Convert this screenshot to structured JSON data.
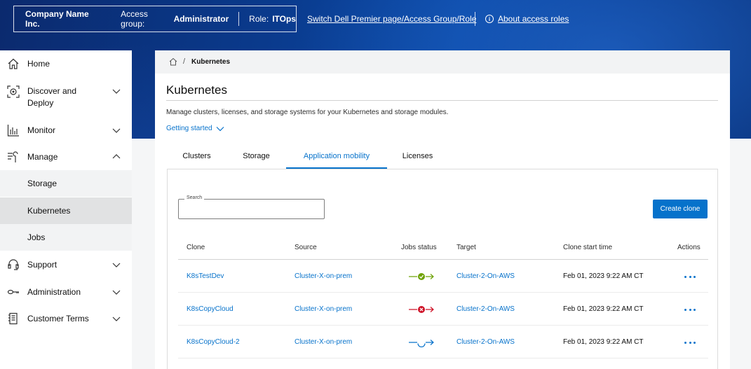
{
  "header": {
    "company": "Company Name Inc.",
    "access_group_label": "Access group:",
    "access_group_value": "Administrator",
    "role_label": "Role:",
    "role_value": "ITOps",
    "switch_link": "Switch Dell Premier page/Access Group/Role",
    "about_link": "About access roles",
    "info_icon": "i"
  },
  "sidebar": {
    "items": [
      {
        "label": "Home",
        "icon": "home-icon"
      },
      {
        "label": "Discover and Deploy",
        "icon": "discover-icon"
      },
      {
        "label": "Monitor",
        "icon": "monitor-icon"
      },
      {
        "label": "Manage",
        "icon": "manage-icon"
      },
      {
        "label": "Support",
        "icon": "headset-icon"
      },
      {
        "label": "Administration",
        "icon": "key-icon"
      },
      {
        "label": "Customer Terms",
        "icon": "document-icon"
      }
    ],
    "manage_subitems": [
      "Storage",
      "Kubernetes",
      "Jobs"
    ],
    "active_subitem": "Kubernetes"
  },
  "breadcrumb": {
    "separator": "/",
    "current": "Kubernetes"
  },
  "page": {
    "title": "Kubernetes",
    "description": "Manage clusters, licenses, and storage systems for your Kubernetes and storage modules.",
    "getting_started": "Getting started"
  },
  "tabs": [
    {
      "label": "Clusters",
      "active": false
    },
    {
      "label": "Storage",
      "active": false
    },
    {
      "label": "Application mobility",
      "active": true
    },
    {
      "label": "Licenses",
      "active": false
    }
  ],
  "search": {
    "label": "Search",
    "value": ""
  },
  "create_button": "Create clone",
  "table": {
    "headers": [
      "Clone",
      "Source",
      "Jobs status",
      "Target",
      "Clone start time",
      "Actions"
    ],
    "rows": [
      {
        "clone": "K8sTestDev",
        "source": "Cluster-X-on-prem",
        "status": "success",
        "target": "Cluster-2-On-AWS",
        "start": "Feb 01, 2023 9:22 AM CT"
      },
      {
        "clone": "K8sCopyCloud",
        "source": "Cluster-X-on-prem",
        "status": "failed",
        "target": "Cluster-2-On-AWS",
        "start": "Feb 01, 2023 9:22 AM CT"
      },
      {
        "clone": "K8sCopyCloud-2",
        "source": "Cluster-X-on-prem",
        "status": "in-progress",
        "target": "Cluster-2-On-AWS",
        "start": "Feb 01, 2023 9:22 AM CT"
      }
    ]
  },
  "colors": {
    "accent": "#0672cb",
    "success": "#6ea204",
    "error": "#ce1126",
    "banner": "#0b3f96"
  }
}
